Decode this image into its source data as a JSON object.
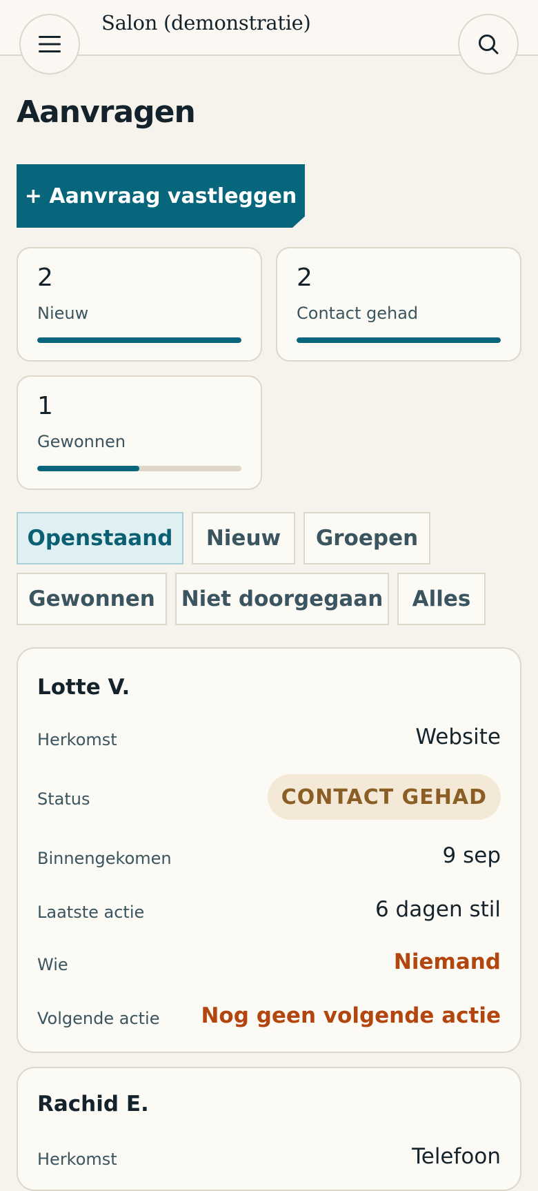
{
  "header": {
    "app_title": "Salon (demonstratie)",
    "menu_icon": "hamburger-menu-icon",
    "search_icon": "search-icon"
  },
  "page": {
    "title": "Aanvragen",
    "primary_action": "+ Aanvraag vastleggen"
  },
  "stats": [
    {
      "count": "2",
      "label": "Nieuw",
      "progress": 1.0
    },
    {
      "count": "2",
      "label": "Contact gehad",
      "progress": 1.0
    },
    {
      "count": "1",
      "label": "Gewonnen",
      "progress": 0.5
    }
  ],
  "filters": [
    {
      "label": "Openstaand",
      "active": true
    },
    {
      "label": "Nieuw",
      "active": false
    },
    {
      "label": "Groepen",
      "active": false
    },
    {
      "label": "Gewonnen",
      "active": false
    },
    {
      "label": "Niet doorgegaan",
      "active": false
    },
    {
      "label": "Alles",
      "active": false
    }
  ],
  "colors": {
    "accent": "#08667c",
    "background": "#f6f3ec",
    "warning": "#b3460e",
    "badge_bg": "#f3e9d6",
    "badge_text": "#8b5e25"
  },
  "requests": [
    {
      "name": "Lotte V.",
      "origin_label": "Herkomst",
      "origin": "Website",
      "status_label": "Status",
      "status": "CONTACT GEHAD",
      "received_label": "Binnengekomen",
      "received": "9 sep",
      "last_action_label": "Laatste actie",
      "last_action": "6 dagen stil",
      "who_label": "Wie",
      "who": "Niemand",
      "next_action_label": "Volgende actie",
      "next_action": "Nog geen volgende actie"
    },
    {
      "name": "Rachid E.",
      "origin_label": "Herkomst",
      "origin": "Telefoon"
    }
  ]
}
